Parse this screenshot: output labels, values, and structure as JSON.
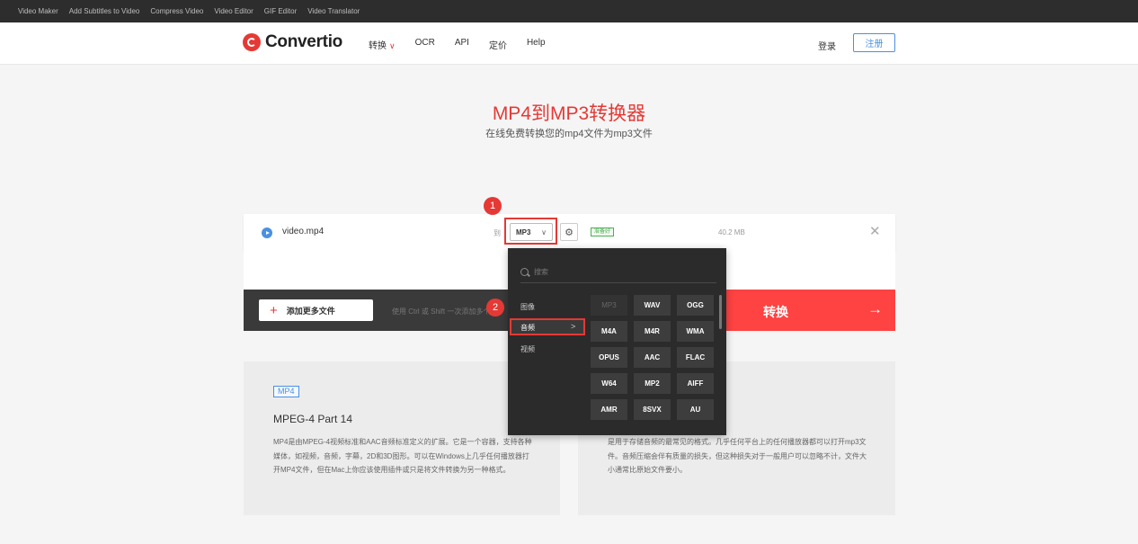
{
  "topbar": {
    "links": [
      "Video Maker",
      "Add Subtitles to Video",
      "Compress Video",
      "Video Editor",
      "GIF Editor",
      "Video Translator"
    ]
  },
  "header": {
    "logo_text": "Convertio",
    "nav": {
      "convert": "转换",
      "ocr": "OCR",
      "api": "API",
      "pricing": "定价",
      "help": "Help"
    },
    "login": "登录",
    "signup": "注册"
  },
  "hero": {
    "title": "MP4到MP3转换器",
    "subtitle": "在线免费转换您的mp4文件为mp3文件"
  },
  "file": {
    "name": "video.mp4",
    "to_label": "到",
    "format": "MP3",
    "status": "准备好",
    "size": "40.2 MB"
  },
  "actions": {
    "add_more": "添加更多文件",
    "hint": "使用 Ctrl 或 Shift 一次添加多个",
    "convert": "转换"
  },
  "badges": {
    "one": "1",
    "two": "2"
  },
  "dropdown": {
    "search_placeholder": "搜索",
    "categories": {
      "image": "图像",
      "audio": "音频",
      "video": "视频"
    },
    "formats": [
      "MP3",
      "WAV",
      "OGG",
      "M4A",
      "M4R",
      "WMA",
      "OPUS",
      "AAC",
      "FLAC",
      "W64",
      "MP2",
      "AIFF",
      "AMR",
      "8SVX",
      "AU"
    ]
  },
  "cards": {
    "left": {
      "tag": "MP4",
      "title": "MPEG-4 Part 14",
      "text": "MP4是由MPEG-4视频标准和AAC音频标准定义的扩展。它是一个容器，支持各种媒体，如视频，音频，字幕，2D和3D图形。可以在Windows上几乎任何播放器打开MP4文件，但在Mac上你应该使用插件或只是将文件转换为另一种格式。"
    },
    "right": {
      "text": "是用于存储音频的最常见的格式。几乎任何平台上的任何播放器都可以打开mp3文件。音频压缩会伴有质量的损失，但这种损失对于一般用户可以忽略不计，文件大小通常比原始文件要小。"
    }
  }
}
